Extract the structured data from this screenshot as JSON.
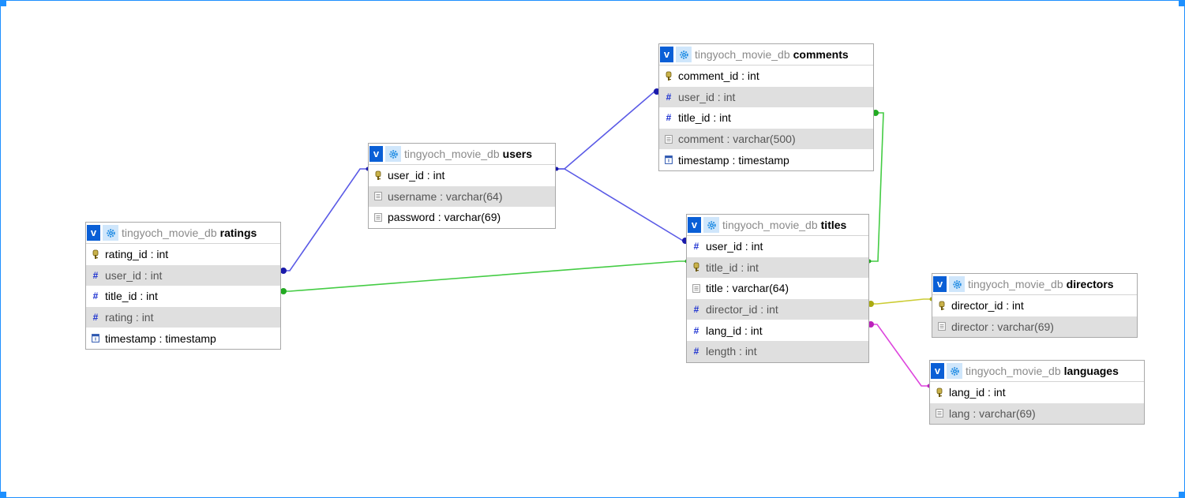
{
  "database": "tingyoch_movie_db",
  "colors": {
    "frame": "#1e90ff",
    "link_blue": "#5a5ae6",
    "link_green": "#44cc44",
    "link_yellow": "#cccc33",
    "link_magenta": "#dd44dd"
  },
  "tables": [
    {
      "id": "comments",
      "db": "tingyoch_movie_db",
      "name": "comments",
      "fields": [
        {
          "label": "comment_id : int",
          "icon": "key-icon"
        },
        {
          "label": "user_id : int",
          "icon": "hash-icon"
        },
        {
          "label": "title_id : int",
          "icon": "hash-icon"
        },
        {
          "label": "comment : varchar(500)",
          "icon": "text-field-icon"
        },
        {
          "label": "timestamp : timestamp",
          "icon": "clock-icon"
        }
      ]
    },
    {
      "id": "users",
      "db": "tingyoch_movie_db",
      "name": "users",
      "fields": [
        {
          "label": "user_id : int",
          "icon": "key-icon"
        },
        {
          "label": "username : varchar(64)",
          "icon": "text-field-icon"
        },
        {
          "label": "password : varchar(69)",
          "icon": "text-field-icon"
        }
      ]
    },
    {
      "id": "ratings",
      "db": "tingyoch_movie_db",
      "name": "ratings",
      "fields": [
        {
          "label": "rating_id : int",
          "icon": "key-icon"
        },
        {
          "label": "user_id : int",
          "icon": "hash-icon"
        },
        {
          "label": "title_id : int",
          "icon": "hash-icon"
        },
        {
          "label": "rating : int",
          "icon": "hash-icon"
        },
        {
          "label": "timestamp : timestamp",
          "icon": "clock-icon"
        }
      ]
    },
    {
      "id": "titles",
      "db": "tingyoch_movie_db",
      "name": "titles",
      "fields": [
        {
          "label": "user_id : int",
          "icon": "hash-icon"
        },
        {
          "label": "title_id : int",
          "icon": "key-icon"
        },
        {
          "label": "title : varchar(64)",
          "icon": "text-field-icon"
        },
        {
          "label": "director_id : int",
          "icon": "hash-icon"
        },
        {
          "label": "lang_id : int",
          "icon": "hash-icon"
        },
        {
          "label": "length : int",
          "icon": "hash-icon"
        }
      ]
    },
    {
      "id": "directors",
      "db": "tingyoch_movie_db",
      "name": "directors",
      "fields": [
        {
          "label": "director_id : int",
          "icon": "key-icon"
        },
        {
          "label": "director : varchar(69)",
          "icon": "text-field-icon"
        }
      ]
    },
    {
      "id": "languages",
      "db": "tingyoch_movie_db",
      "name": "languages",
      "fields": [
        {
          "label": "lang_id : int",
          "icon": "key-icon"
        },
        {
          "label": "lang : varchar(69)",
          "icon": "text-field-icon"
        }
      ]
    }
  ],
  "relations": [
    {
      "from": "users.user_id",
      "to": "comments.user_id",
      "color": "#5a5ae6"
    },
    {
      "from": "users.user_id",
      "to": "titles.user_id",
      "color": "#5a5ae6"
    },
    {
      "from": "users.user_id",
      "to": "ratings.user_id",
      "color": "#5a5ae6"
    },
    {
      "from": "titles.title_id",
      "to": "comments.title_id",
      "color": "#44cc44"
    },
    {
      "from": "titles.title_id",
      "to": "ratings.title_id",
      "color": "#44cc44"
    },
    {
      "from": "titles.director_id",
      "to": "directors.director_id",
      "color": "#cccc33"
    },
    {
      "from": "titles.lang_id",
      "to": "languages.lang_id",
      "color": "#dd44dd"
    }
  ]
}
